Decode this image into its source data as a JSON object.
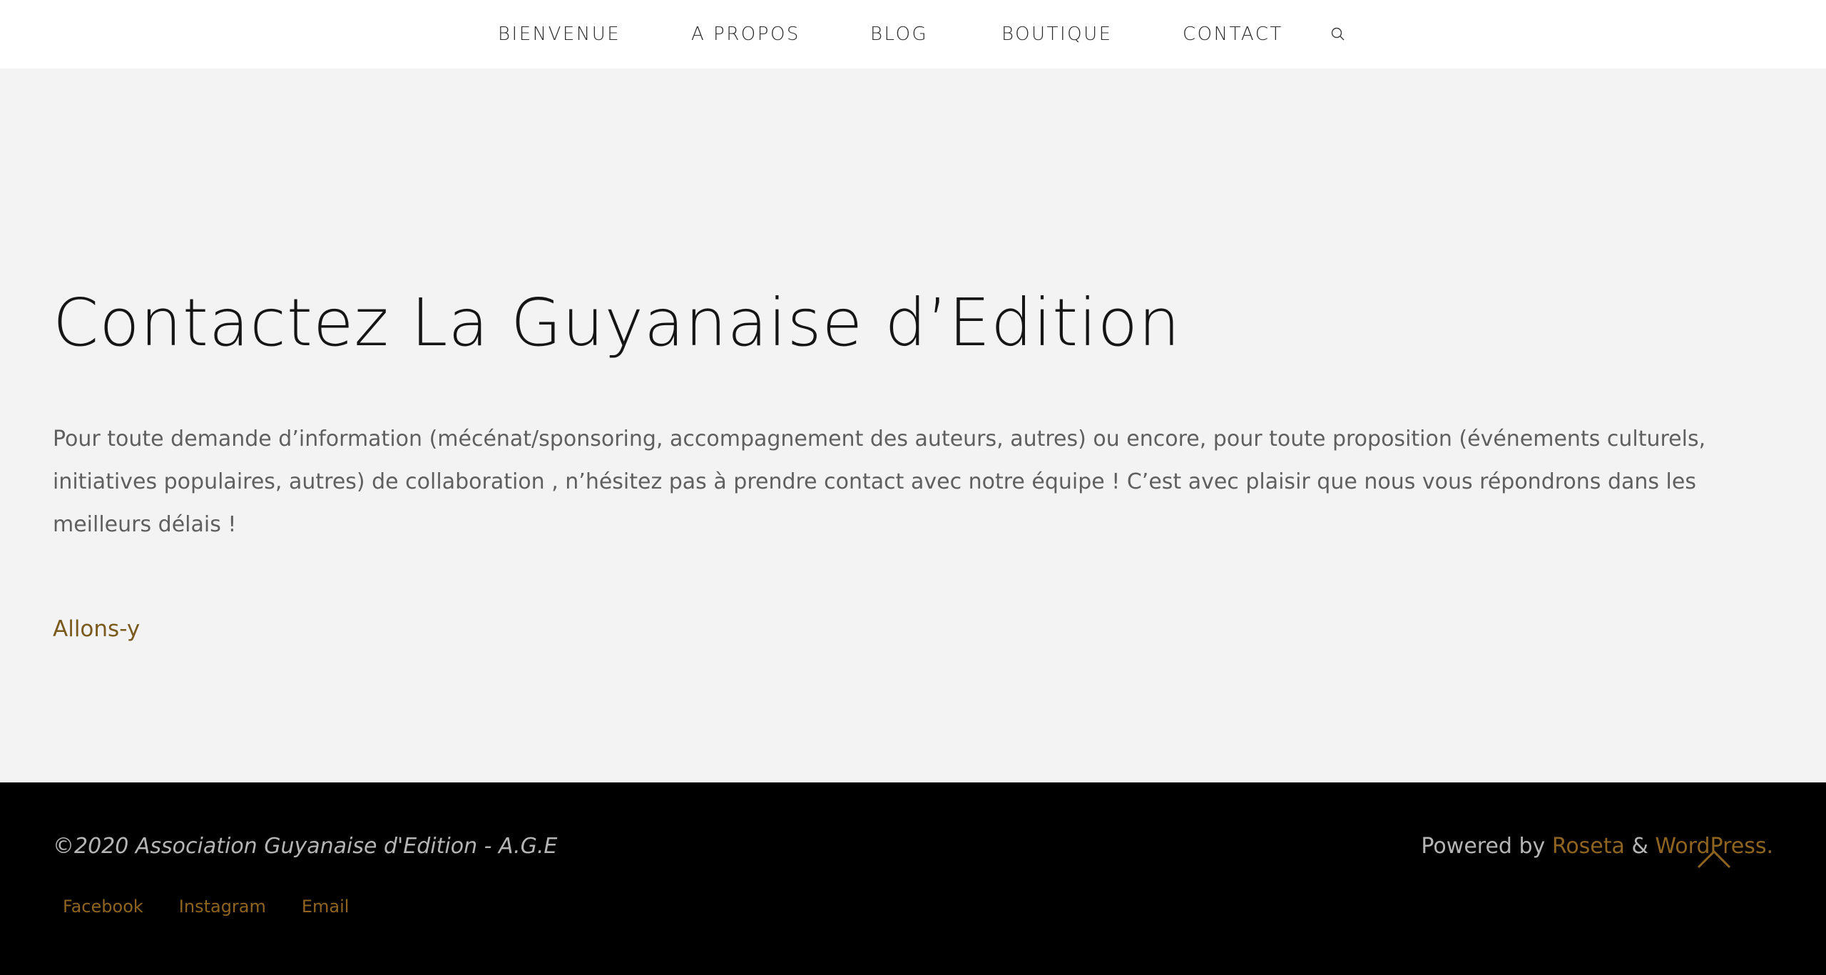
{
  "nav": {
    "items": [
      {
        "label": "BIENVENUE"
      },
      {
        "label": "A PROPOS"
      },
      {
        "label": "BLOG"
      },
      {
        "label": "BOUTIQUE"
      },
      {
        "label": "CONTACT"
      }
    ],
    "search_icon": "search-icon"
  },
  "main": {
    "title": "Contactez La Guyanaise d’Edition",
    "intro": "Pour toute demande d’information (mécénat/sponsoring, accompagnement des auteurs, autres) ou encore, pour toute proposition (événements culturels, initiatives populaires, autres) de collaboration , n’hésitez pas à prendre contact avec notre équipe ! C’est avec plaisir que nous vous répondrons dans les meilleurs délais !",
    "cta_label": "Allons-y"
  },
  "footer": {
    "copyright": "©2020 Association Guyanaise d'Edition - A.G.E",
    "powered_prefix": "Powered by ",
    "theme_link": "Roseta",
    "separator": " & ",
    "platform_link": "WordPress.",
    "social": [
      {
        "label": "Facebook"
      },
      {
        "label": "Instagram"
      },
      {
        "label": "Email"
      }
    ],
    "back_to_top_icon": "chevron-up-icon"
  },
  "colors": {
    "accent": "#8f6420",
    "cta": "#7a5a1c",
    "header_bg": "#ffffff",
    "main_bg": "#f3f3f3",
    "footer_bg": "#000000"
  }
}
